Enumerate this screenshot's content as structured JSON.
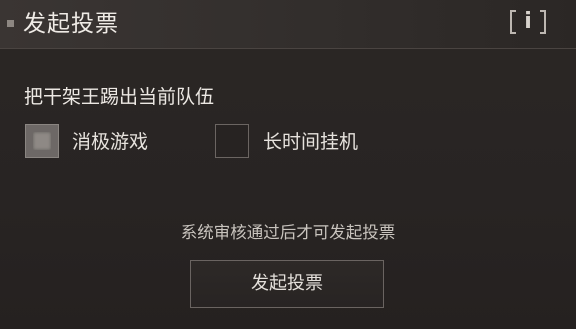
{
  "dialog": {
    "title": "发起投票",
    "info_icon_glyph": "i",
    "info_icon": "info-icon"
  },
  "vote": {
    "prompt": "把干架王踢出当前队伍",
    "options": [
      {
        "label": "消极游戏",
        "checked": true
      },
      {
        "label": "长时间挂机",
        "checked": false
      }
    ],
    "notice": "系统审核通过后才可发起投票",
    "submit_label": "发起投票"
  },
  "colors": {
    "background": "#2b2725",
    "header": "#3a3533",
    "text": "#ece8e3",
    "border": "#6a6461"
  }
}
